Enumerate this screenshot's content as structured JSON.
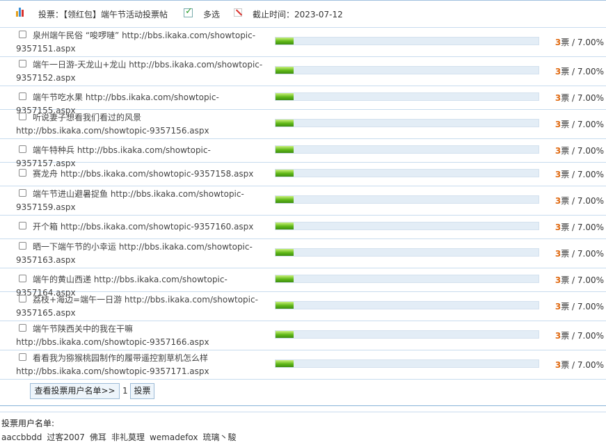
{
  "header": {
    "title": "投票：【领红包】端午节活动投票帖",
    "multi_label": "多选",
    "deadline": "截止时间：2023-07-12",
    "icons": [
      "bar-chart-icon",
      "checkbox-checked-icon",
      "edit-icon"
    ]
  },
  "options": [
    {
      "text": "泉州端午民俗 “唆啰嗹” http://bbs.ikaka.com/showtopic-9357151.aspx",
      "votes": "3",
      "percent": "7.00%",
      "share": 0.07
    },
    {
      "text": "端午一日游-天龙山+龙山 http://bbs.ikaka.com/showtopic-9357152.aspx",
      "votes": "3",
      "percent": "7.00%",
      "share": 0.07
    },
    {
      "text": "端午节吃水果 http://bbs.ikaka.com/showtopic-9357155.aspx",
      "votes": "3",
      "percent": "7.00%",
      "share": 0.07
    },
    {
      "text": "听说妻子想看我们看过的风景 http://bbs.ikaka.com/showtopic-9357156.aspx",
      "votes": "3",
      "percent": "7.00%",
      "share": 0.07
    },
    {
      "text": "端午特种兵 http://bbs.ikaka.com/showtopic-9357157.aspx",
      "votes": "3",
      "percent": "7.00%",
      "share": 0.07
    },
    {
      "text": "赛龙舟 http://bbs.ikaka.com/showtopic-9357158.aspx",
      "votes": "3",
      "percent": "7.00%",
      "share": 0.07
    },
    {
      "text": "端午节进山避暑捉鱼 http://bbs.ikaka.com/showtopic-9357159.aspx",
      "votes": "3",
      "percent": "7.00%",
      "share": 0.07
    },
    {
      "text": "开个箱 http://bbs.ikaka.com/showtopic-9357160.aspx",
      "votes": "3",
      "percent": "7.00%",
      "share": 0.07
    },
    {
      "text": "晒一下端午节的小幸运 http://bbs.ikaka.com/showtopic-9357163.aspx",
      "votes": "3",
      "percent": "7.00%",
      "share": 0.07
    },
    {
      "text": "端午的黄山西递 http://bbs.ikaka.com/showtopic-9357164.aspx",
      "votes": "3",
      "percent": "7.00%",
      "share": 0.07
    },
    {
      "text": "荔枝+海边=端午一日游 http://bbs.ikaka.com/showtopic-9357165.aspx",
      "votes": "3",
      "percent": "7.00%",
      "share": 0.07
    },
    {
      "text": "端午节陕西关中的我在干嘛 http://bbs.ikaka.com/showtopic-9357166.aspx",
      "votes": "3",
      "percent": "7.00%",
      "share": 0.07
    },
    {
      "text": "看看我为猕猴桃园制作的履带遥控割草机怎么样 http://bbs.ikaka.com/showtopic-9357171.aspx",
      "votes": "3",
      "percent": "7.00%",
      "share": 0.07
    }
  ],
  "vote_unit": "票",
  "result_sep": " / ",
  "actions": {
    "view_voters_label": "查看投票用户名单>>",
    "page_number": "1",
    "vote_label": "投票"
  },
  "voters": {
    "title": "投票用户名单:",
    "names": [
      "aaccbbdd",
      "过客2007",
      "佛耳",
      "非礼莫理",
      "wemadefox",
      "琉璃丶駿"
    ]
  },
  "colors": {
    "votes_accent": "#e06a12",
    "bar_fill": "#5fb817",
    "bar_track": "#e3edf6",
    "divider": "#c7dbee"
  }
}
